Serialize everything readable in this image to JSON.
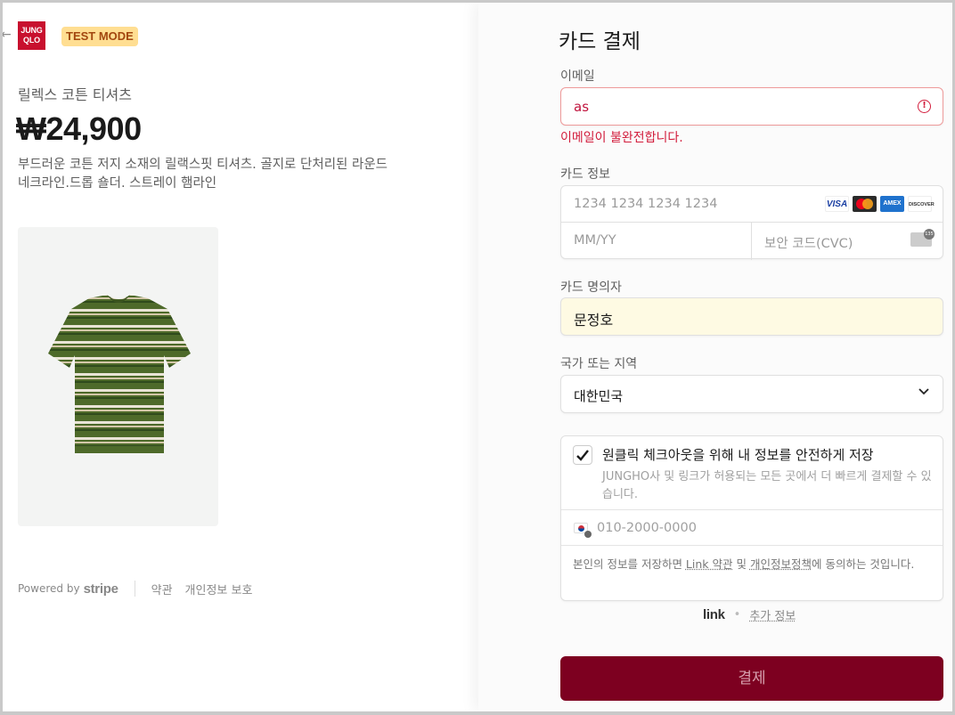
{
  "brand": {
    "logo_line1": "JUNG",
    "logo_line2": "QLO",
    "badge": "TEST MODE",
    "back_icon": "arrow-left-icon"
  },
  "product": {
    "name": "릴렉스 코튼 티셔츠",
    "price": "₩24,900",
    "description": "부드러운 코튼 저지 소재의 릴랙스핏 티셔츠. 골지로 단처리된 라운드 네크라인.드롭 숄더. 스트레이 햄라인"
  },
  "footer": {
    "powered_by": "Powered by",
    "stripe": "stripe",
    "terms": "약관",
    "privacy": "개인정보 보호"
  },
  "form": {
    "title": "카드 결제",
    "email_label": "이메일",
    "email_value": "as",
    "email_error": "이메일이 불완전합니다.",
    "card_label": "카드 정보",
    "card_number_placeholder": "1234 1234 1234 1234",
    "expiry_placeholder": "MM/YY",
    "cvc_placeholder": "보안 코드(CVC)",
    "card_brands": [
      "VISA",
      "MC",
      "AMEX",
      "DISCOVER"
    ],
    "name_label": "카드 명의자",
    "name_value": "문정호",
    "country_label": "국가 또는 지역",
    "country_value": "대한민국",
    "link": {
      "save_label": "원클릭 체크아웃을 위해 내 정보를 안전하게 저장",
      "save_desc": "JUNGHO사 및 링크가 허용되는 모든 곳에서 더 빠르게 결제할 수 있습니다.",
      "phone_placeholder": "010-2000-0000",
      "terms_prefix": "본인의 정보를 저장하면 ",
      "terms_link": "Link 약관",
      "terms_and": " 및 ",
      "privacy_link": "개인정보정책",
      "terms_suffix": "에 동의하는 것입니다."
    },
    "link_logo": "link",
    "more_info": "추가 정보",
    "pay_button": "결제"
  },
  "colors": {
    "accent": "#7d0020",
    "error": "#d21d3c",
    "badge_bg": "#ffde92",
    "autofill_bg": "#fefae3"
  }
}
